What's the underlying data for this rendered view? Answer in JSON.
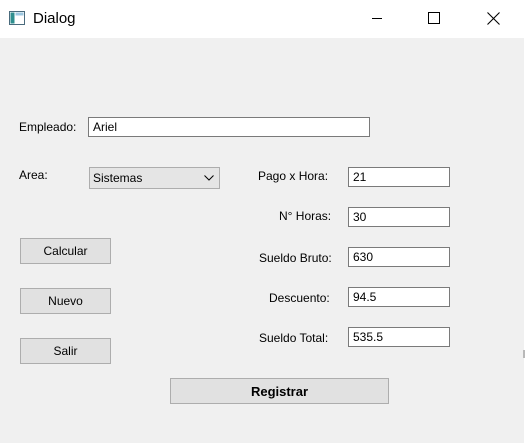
{
  "window": {
    "title": "Dialog"
  },
  "form": {
    "empleado_label": "Empleado:",
    "empleado_value": "Ariel",
    "area_label": "Area:",
    "area_selected": "Sistemas",
    "pago_hora_label": "Pago x Hora:",
    "pago_hora_value": "21",
    "horas_label": "N° Horas:",
    "horas_value": "30",
    "sueldo_bruto_label": "Sueldo Bruto:",
    "sueldo_bruto_value": "630",
    "descuento_label": "Descuento:",
    "descuento_value": "94.5",
    "sueldo_total_label": "Sueldo Total:",
    "sueldo_total_value": "535.5"
  },
  "buttons": {
    "calcular": "Calcular",
    "nuevo": "Nuevo",
    "salir": "Salir",
    "registrar": "Registrar"
  }
}
